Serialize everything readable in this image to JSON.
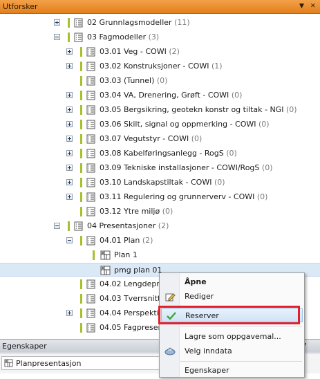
{
  "explorer": {
    "title": "Utforsker",
    "pin_glyph": "▼",
    "close_glyph": "✕"
  },
  "tree": [
    {
      "label": "02 Grunnlagsmodeller",
      "count": "(11)",
      "expander": "plus",
      "icon": "checklist-icon"
    },
    {
      "label": "03 Fagmodeller",
      "count": "(3)",
      "expander": "minus",
      "icon": "checklist-icon"
    },
    {
      "label": "03.01 Veg - COWI",
      "count": "(2)",
      "expander": "plus",
      "icon": "checklist-icon"
    },
    {
      "label": "03.02 Konstruksjoner - COWI",
      "count": "(1)",
      "expander": "plus",
      "icon": "checklist-icon"
    },
    {
      "label": "03.03 (Tunnel)",
      "count": "(0)",
      "expander": "none",
      "icon": "checklist-icon"
    },
    {
      "label": "03.04 VA, Drenering, Grøft - COWI",
      "count": "(0)",
      "expander": "plus",
      "icon": "checklist-icon"
    },
    {
      "label": "03.05 Bergsikring, geotekn konstr og tiltak - NGI",
      "count": "(0)",
      "expander": "plus",
      "icon": "checklist-icon"
    },
    {
      "label": "03.06 Skilt, signal og oppmerking - COWI",
      "count": "(0)",
      "expander": "plus",
      "icon": "checklist-icon"
    },
    {
      "label": "03.07 Vegutstyr - COWI",
      "count": "(0)",
      "expander": "plus",
      "icon": "checklist-icon"
    },
    {
      "label": "03.08 Kabelføringsanlegg - RogS",
      "count": "(0)",
      "expander": "plus",
      "icon": "checklist-icon"
    },
    {
      "label": "03.09 Tekniske installasjoner - COWI/RogS",
      "count": "(0)",
      "expander": "plus",
      "icon": "checklist-icon"
    },
    {
      "label": "03.10 Landskapstiltak - COWI",
      "count": "(0)",
      "expander": "plus",
      "icon": "checklist-icon"
    },
    {
      "label": "03.11 Regulering og grunnerverv - COWI",
      "count": "(0)",
      "expander": "plus",
      "icon": "checklist-icon"
    },
    {
      "label": "03.12 Ytre miljø",
      "count": "(0)",
      "expander": "none",
      "icon": "checklist-icon"
    },
    {
      "label": "04 Presentasjoner",
      "count": "(2)",
      "expander": "minus",
      "icon": "checklist-icon"
    },
    {
      "label": "04.01 Plan",
      "count": "(2)",
      "expander": "minus",
      "icon": "checklist-icon"
    },
    {
      "label": "Plan 1",
      "count": "",
      "expander": "none",
      "icon": "plan-icon"
    },
    {
      "label": "pmg plan 01",
      "count": "",
      "expander": "none",
      "icon": "plan-icon"
    },
    {
      "label": "04.02 Lengdepro",
      "count": "",
      "expander": "none",
      "icon": "checklist-icon"
    },
    {
      "label": "04.03 Tverrsnitt",
      "count": "",
      "expander": "none",
      "icon": "checklist-icon"
    },
    {
      "label": "04.04 Perspektiv",
      "count": "",
      "expander": "plus",
      "icon": "checklist-icon"
    },
    {
      "label": "04.05 Fagpresent",
      "count": "",
      "expander": "none",
      "icon": "checklist-icon"
    }
  ],
  "properties": {
    "title": "Egenskaper",
    "value": "Planpresentasjon"
  },
  "context_menu": {
    "items": [
      {
        "label": "Åpne",
        "icon": "",
        "bold": true
      },
      {
        "label": "Rediger",
        "icon": "edit-icon"
      },
      {
        "label": "Reserver",
        "icon": "checkmark-icon"
      },
      {
        "label": "Lagre som oppgavemal...",
        "icon": ""
      },
      {
        "label": "Velg inndata",
        "icon": "input-icon"
      },
      {
        "label": "Egenskaper",
        "icon": ""
      }
    ],
    "highlight_color": "#e0202a"
  }
}
